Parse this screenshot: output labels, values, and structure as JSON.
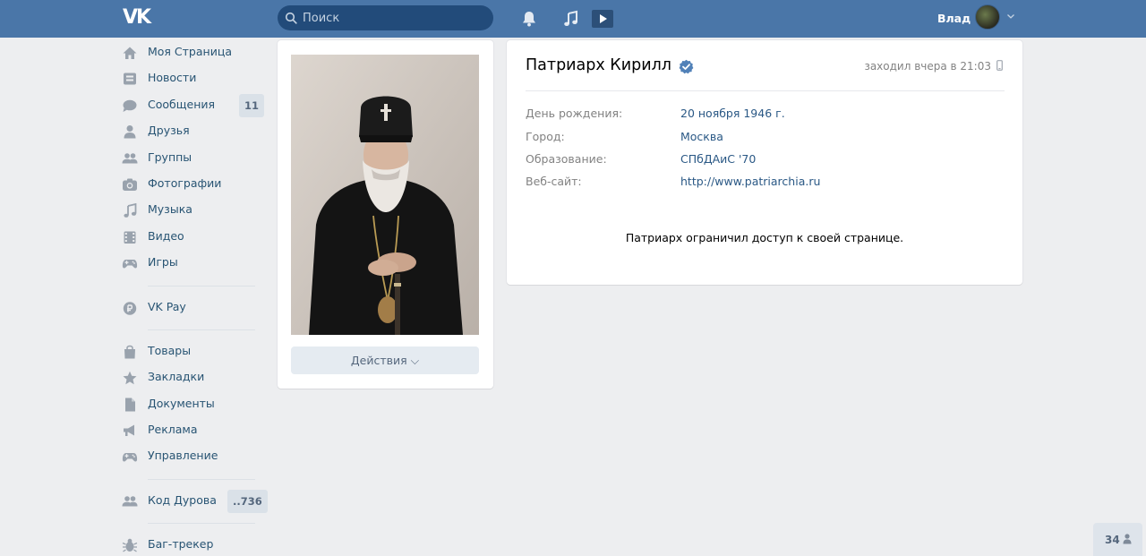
{
  "header": {
    "logo": "VK",
    "search_placeholder": "Поиск",
    "user_name": "Влад"
  },
  "sidebar": {
    "items": [
      {
        "label": "Моя Страница",
        "icon": "home-icon"
      },
      {
        "label": "Новости",
        "icon": "news-icon"
      },
      {
        "label": "Сообщения",
        "icon": "messages-icon",
        "badge": "11"
      },
      {
        "label": "Друзья",
        "icon": "user-icon"
      },
      {
        "label": "Группы",
        "icon": "groups-icon"
      },
      {
        "label": "Фотографии",
        "icon": "camera-icon"
      },
      {
        "label": "Музыка",
        "icon": "music-icon"
      },
      {
        "label": "Видео",
        "icon": "video-icon"
      },
      {
        "label": "Игры",
        "icon": "gamepad-icon"
      }
    ],
    "pay": {
      "label": "VK Pay",
      "icon": "vkpay-icon"
    },
    "items2": [
      {
        "label": "Товары",
        "icon": "bag-icon"
      },
      {
        "label": "Закладки",
        "icon": "star-icon"
      },
      {
        "label": "Документы",
        "icon": "document-icon"
      },
      {
        "label": "Реклама",
        "icon": "megaphone-icon"
      },
      {
        "label": "Управление",
        "icon": "gamepad-icon"
      }
    ],
    "durov": {
      "label": "Код Дурова",
      "icon": "groups-icon",
      "badge": "..736"
    },
    "bugtracker": {
      "label": "Баг-трекер",
      "icon": "bug-icon"
    }
  },
  "photo_card": {
    "actions_label": "Действия ⌵"
  },
  "profile": {
    "name": "Патриарх Кирилл",
    "online_status": "заходил вчера в 21:03",
    "info": [
      {
        "key": "День рождения:",
        "value": "20 ноября 1946 г."
      },
      {
        "key": "Город:",
        "value": "Москва"
      },
      {
        "key": "Образование:",
        "value": "СПбДАиС '70"
      },
      {
        "key": "Веб-сайт:",
        "value": "http://www.patriarchia.ru"
      }
    ],
    "restricted_message": "Патриарх ограничил доступ к своей странице."
  },
  "online_counter": "34",
  "colors": {
    "header_bg": "#4a76a8",
    "link": "#2a5885",
    "page_bg": "#edeef0"
  }
}
